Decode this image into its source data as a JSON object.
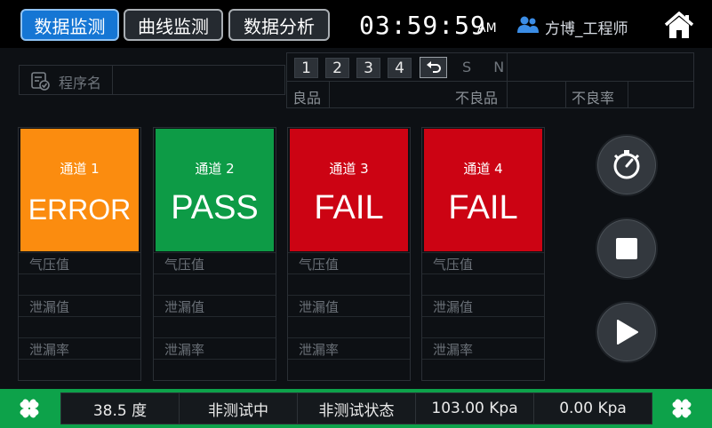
{
  "header": {
    "tabs": [
      {
        "label": "数据监测",
        "active": true
      },
      {
        "label": "曲线监测",
        "active": false
      },
      {
        "label": "数据分析",
        "active": false
      }
    ],
    "time": "03:59:59",
    "ampm": "AM",
    "user_name": "方博_工程师",
    "home_icon": "home-icon"
  },
  "program": {
    "label": "程序名",
    "value": ""
  },
  "stats": {
    "channel_buttons": [
      "1",
      "2",
      "3",
      "4"
    ],
    "sn_label": "S N",
    "good_label": "良品",
    "bad_label": "不良品",
    "bad_rate_label": "不良率"
  },
  "channels": [
    {
      "title": "通道 1",
      "status": "ERROR",
      "color": "#fb8c0f",
      "rows": [
        "气压值",
        "泄漏值",
        "泄漏率"
      ]
    },
    {
      "title": "通道 2",
      "status": "PASS",
      "color": "#0d9b46",
      "rows": [
        "气压值",
        "泄漏值",
        "泄漏率"
      ]
    },
    {
      "title": "通道 3",
      "status": "FAIL",
      "color": "#cc0313",
      "rows": [
        "气压值",
        "泄漏值",
        "泄漏率"
      ]
    },
    {
      "title": "通道 4",
      "status": "FAIL",
      "color": "#cc0313",
      "rows": [
        "气压值",
        "泄漏值",
        "泄漏率"
      ]
    }
  ],
  "controls": [
    "gauge-icon",
    "stop-icon",
    "play-icon"
  ],
  "footer": {
    "temperature": "38.5 度",
    "test_state": "非测试中",
    "test_status": "非测试状态",
    "pressure_1": "103.00 Kpa",
    "pressure_2": "0.00 Kpa",
    "color": "#0da24a"
  }
}
